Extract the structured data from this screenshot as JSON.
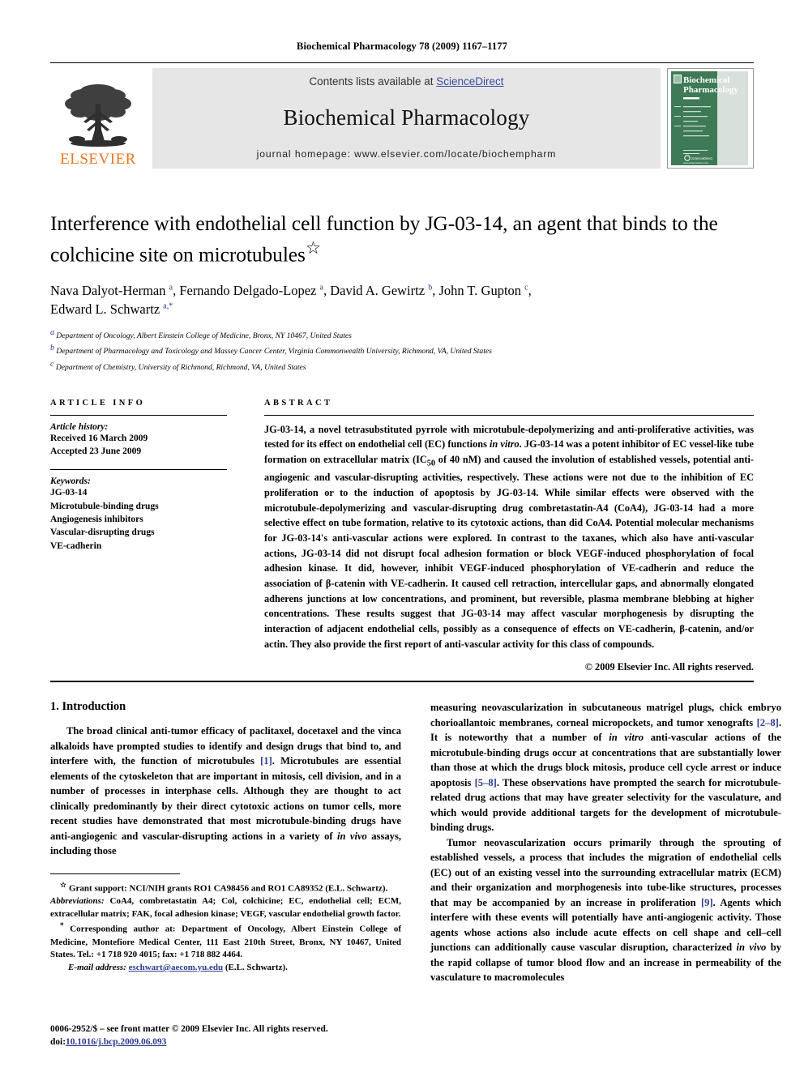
{
  "running_head": "Biochemical Pharmacology 78 (2009) 1167–1177",
  "banner": {
    "contents_prefix": "Contents lists available at ",
    "sciencedirect": "ScienceDirect",
    "journal_name": "Biochemical Pharmacology",
    "homepage": "journal homepage: www.elsevier.com/locate/biochempharm",
    "publisher_word": "ELSEVIER",
    "cover_title_line1": "Biochemical",
    "cover_title_line2": "Pharmacology",
    "cover_footer": "ScienceDirect",
    "cover_url": "www.sciencedirect.com"
  },
  "colors": {
    "link": "#2b3a8f",
    "sciencedirect": "#3b4ba5",
    "elsevier_orange": "#E87722",
    "banner_gray": "#e6e6e6",
    "cover_green": "#3d7a55"
  },
  "article": {
    "title": "Interference with endothelial cell function by JG-03-14, an agent that binds to the colchicine site on microtubules",
    "title_marker": "☆",
    "authors_line1": "Nava Dalyot-Herman a, Fernando Delgado-Lopez a, David A. Gewirtz b, John T. Gupton c,",
    "authors_line2": "Edward L. Schwartz a,*",
    "affiliations": [
      {
        "mark": "a",
        "text": "Department of Oncology, Albert Einstein College of Medicine, Bronx, NY 10467, United States"
      },
      {
        "mark": "b",
        "text": "Department of Pharmacology and Toxicology and Massey Cancer Center, Virginia Commonwealth University, Richmond, VA, United States"
      },
      {
        "mark": "c",
        "text": "Department of Chemistry, University of Richmond, Richmond, VA, United States"
      }
    ]
  },
  "article_info": {
    "heading": "ARTICLE INFO",
    "history_label": "Article history:",
    "received": "Received 16 March 2009",
    "accepted": "Accepted 23 June 2009",
    "keywords_label": "Keywords:",
    "keywords": [
      "JG-03-14",
      "Microtubule-binding drugs",
      "Angiogenesis inhibitors",
      "Vascular-disrupting drugs",
      "VE-cadherin"
    ]
  },
  "abstract": {
    "heading": "ABSTRACT",
    "text": "JG-03-14, a novel tetrasubstituted pyrrole with microtubule-depolymerizing and anti-proliferative activities, was tested for its effect on endothelial cell (EC) functions in vitro. JG-03-14 was a potent inhibitor of EC vessel-like tube formation on extracellular matrix (IC50 of 40 nM) and caused the involution of established vessels, potential anti-angiogenic and vascular-disrupting activities, respectively. These actions were not due to the inhibition of EC proliferation or to the induction of apoptosis by JG-03-14. While similar effects were observed with the microtubule-depolymerizing and vascular-disrupting drug combretastatin-A4 (CoA4), JG-03-14 had a more selective effect on tube formation, relative to its cytotoxic actions, than did CoA4. Potential molecular mechanisms for JG-03-14's anti-vascular actions were explored. In contrast to the taxanes, which also have anti-vascular actions, JG-03-14 did not disrupt focal adhesion formation or block VEGF-induced phosphorylation of focal adhesion kinase. It did, however, inhibit VEGF-induced phosphorylation of VE-cadherin and reduce the association of β-catenin with VE-cadherin. It caused cell retraction, intercellular gaps, and abnormally elongated adherens junctions at low concentrations, and prominent, but reversible, plasma membrane blebbing at higher concentrations. These results suggest that JG-03-14 may affect vascular morphogenesis by disrupting the interaction of adjacent endothelial cells, possibly as a consequence of effects on VE-cadherin, β-catenin, and/or actin. They also provide the first report of anti-vascular activity for this class of compounds.",
    "copyright": "© 2009 Elsevier Inc. All rights reserved."
  },
  "introduction": {
    "heading": "1. Introduction",
    "p1_left": "The broad clinical anti-tumor efficacy of paclitaxel, docetaxel and the vinca alkaloids have prompted studies to identify and design drugs that bind to, and interfere with, the function of microtubules [1]. Microtubules are essential elements of the cytoskeleton that are important in mitosis, cell division, and in a number of processes in interphase cells. Although they are thought to act clinically predominantly by their direct cytotoxic actions on tumor cells, more recent studies have demonstrated that most microtubule-binding drugs have anti-angiogenic and vascular-disrupting actions in a variety of in vivo assays, including those",
    "p1_right": "measuring neovascularization in subcutaneous matrigel plugs, chick embryo chorioallantoic membranes, corneal micropockets, and tumor xenografts [2–8]. It is noteworthy that a number of in vitro anti-vascular actions of the microtubule-binding drugs occur at concentrations that are substantially lower than those at which the drugs block mitosis, produce cell cycle arrest or induce apoptosis [5–8]. These observations have prompted the search for microtubule-related drug actions that may have greater selectivity for the vasculature, and which would provide additional targets for the development of microtubule-binding drugs.",
    "p2_right": "Tumor neovascularization occurs primarily through the sprouting of established vessels, a process that includes the migration of endothelial cells (EC) out of an existing vessel into the surrounding extracellular matrix (ECM) and their organization and morphogenesis into tube-like structures, processes that may be accompanied by an increase in proliferation [9]. Agents which interfere with these events will potentially have anti-angiogenic activity. Those agents whose actions also include acute effects on cell shape and cell–cell junctions can additionally cause vascular disruption, characterized in vivo by the rapid collapse of tumor blood flow and an increase in permeability of the vasculature to macromolecules"
  },
  "footnotes": {
    "grant": "Grant support: NCI/NIH grants RO1 CA98456 and RO1 CA89352 (E.L. Schwartz).",
    "abbreviations_label": "Abbreviations:",
    "abbreviations": "CoA4, combretastatin A4; Col, colchicine; EC, endothelial cell; ECM, extracellular matrix; FAK, focal adhesion kinase; VEGF, vascular endothelial growth factor.",
    "corresponding": "Corresponding author at: Department of Oncology, Albert Einstein College of Medicine, Montefiore Medical Center, 111 East 210th Street, Bronx, NY 10467, United States. Tel.: +1 718 920 4015; fax: +1 718 882 4464.",
    "email_label": "E-mail address:",
    "email": "eschwart@aecom.yu.edu",
    "email_suffix": "(E.L. Schwartz)."
  },
  "footer": {
    "issn_line": "0006-2952/$ – see front matter © 2009 Elsevier Inc. All rights reserved.",
    "doi_label": "doi:",
    "doi": "10.1016/j.bcp.2009.06.093"
  }
}
